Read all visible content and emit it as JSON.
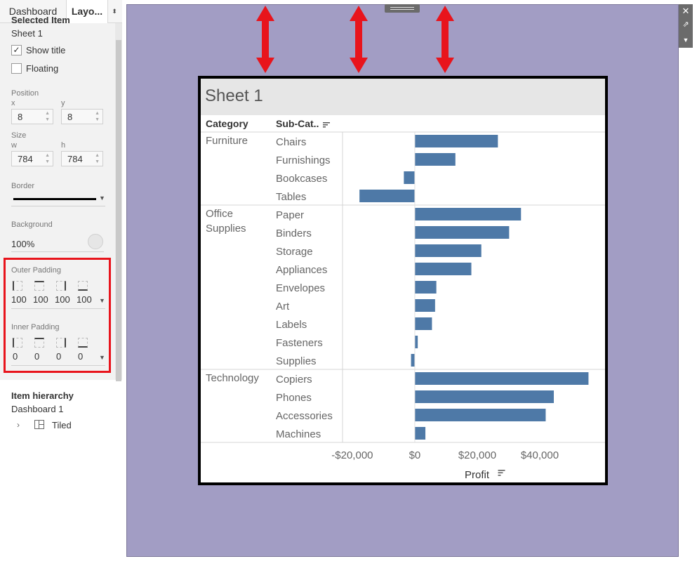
{
  "tabs": {
    "dashboard": "Dashboard",
    "layout": "Layo...",
    "toggle": "⬍"
  },
  "selected_item": {
    "heading": "Selected Item",
    "name": "Sheet 1"
  },
  "options": {
    "show_title": "Show title",
    "show_title_checked": true,
    "floating": "Floating",
    "floating_checked": false
  },
  "position": {
    "label": "Position",
    "x_label": "x",
    "x": "8",
    "y_label": "y",
    "y": "8"
  },
  "size": {
    "label": "Size",
    "w_label": "w",
    "w": "784",
    "h_label": "h",
    "h": "784"
  },
  "border": {
    "label": "Border",
    "color": "#000000"
  },
  "background": {
    "label": "Background",
    "opacity": "100%"
  },
  "outer_padding": {
    "label": "Outer Padding",
    "left": "100",
    "top": "100",
    "right": "100",
    "bottom": "100"
  },
  "inner_padding": {
    "label": "Inner Padding",
    "left": "0",
    "top": "0",
    "right": "0",
    "bottom": "0"
  },
  "hierarchy": {
    "title": "Item hierarchy",
    "dashboard": "Dashboard 1",
    "item": "Tiled"
  },
  "canvas": {
    "background_color": "#a29dc4",
    "arrow_color": "#e8141c"
  },
  "sheet": {
    "title": "Sheet 1"
  },
  "chart_data": {
    "type": "bar",
    "orientation": "horizontal",
    "headers": {
      "category": "Category",
      "subcategory": "Sub-Cat.."
    },
    "xlabel": "Profit",
    "xlim": [
      -22000,
      60000
    ],
    "xticks": [
      -20000,
      0,
      20000,
      40000
    ],
    "xtick_labels": [
      "-$20,000",
      "$0",
      "$20,000",
      "$40,000"
    ],
    "bar_color": "#4e79a7",
    "groups": [
      {
        "category": "Furniture",
        "items": [
          {
            "name": "Chairs",
            "value": 26600
          },
          {
            "name": "Furnishings",
            "value": 13000
          },
          {
            "name": "Bookcases",
            "value": -3500
          },
          {
            "name": "Tables",
            "value": -17700
          }
        ]
      },
      {
        "category": "Office\nSupplies",
        "items": [
          {
            "name": "Paper",
            "value": 34000
          },
          {
            "name": "Binders",
            "value": 30200
          },
          {
            "name": "Storage",
            "value": 21300
          },
          {
            "name": "Appliances",
            "value": 18100
          },
          {
            "name": "Envelopes",
            "value": 6900
          },
          {
            "name": "Art",
            "value": 6500
          },
          {
            "name": "Labels",
            "value": 5500
          },
          {
            "name": "Fasteners",
            "value": 950
          },
          {
            "name": "Supplies",
            "value": -1200
          }
        ]
      },
      {
        "category": "Technology",
        "items": [
          {
            "name": "Copiers",
            "value": 55600
          },
          {
            "name": "Phones",
            "value": 44500
          },
          {
            "name": "Accessories",
            "value": 41900
          },
          {
            "name": "Machines",
            "value": 3400
          }
        ]
      }
    ]
  }
}
